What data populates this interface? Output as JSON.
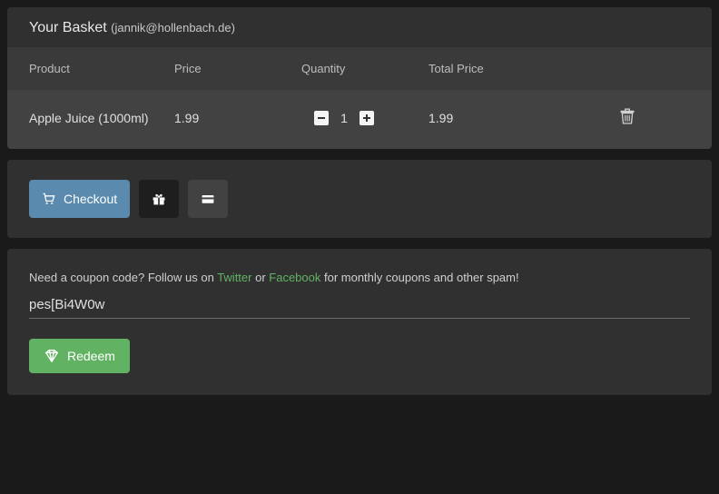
{
  "basket": {
    "title": "Your Basket",
    "email": "(jannik@hollenbach.de)",
    "headers": {
      "product": "Product",
      "price": "Price",
      "quantity": "Quantity",
      "total": "Total Price"
    },
    "items": [
      {
        "product": "Apple Juice (1000ml)",
        "price": "1.99",
        "quantity": "1",
        "total": "1.99"
      }
    ]
  },
  "actions": {
    "checkout_label": "Checkout"
  },
  "coupon": {
    "hint_prefix": "Need a coupon code? Follow us on ",
    "twitter": "Twitter",
    "or": " or ",
    "facebook": "Facebook",
    "hint_suffix": " for monthly coupons and other spam!",
    "input_value": "pes[Bi4W0w",
    "redeem_label": "Redeem"
  }
}
